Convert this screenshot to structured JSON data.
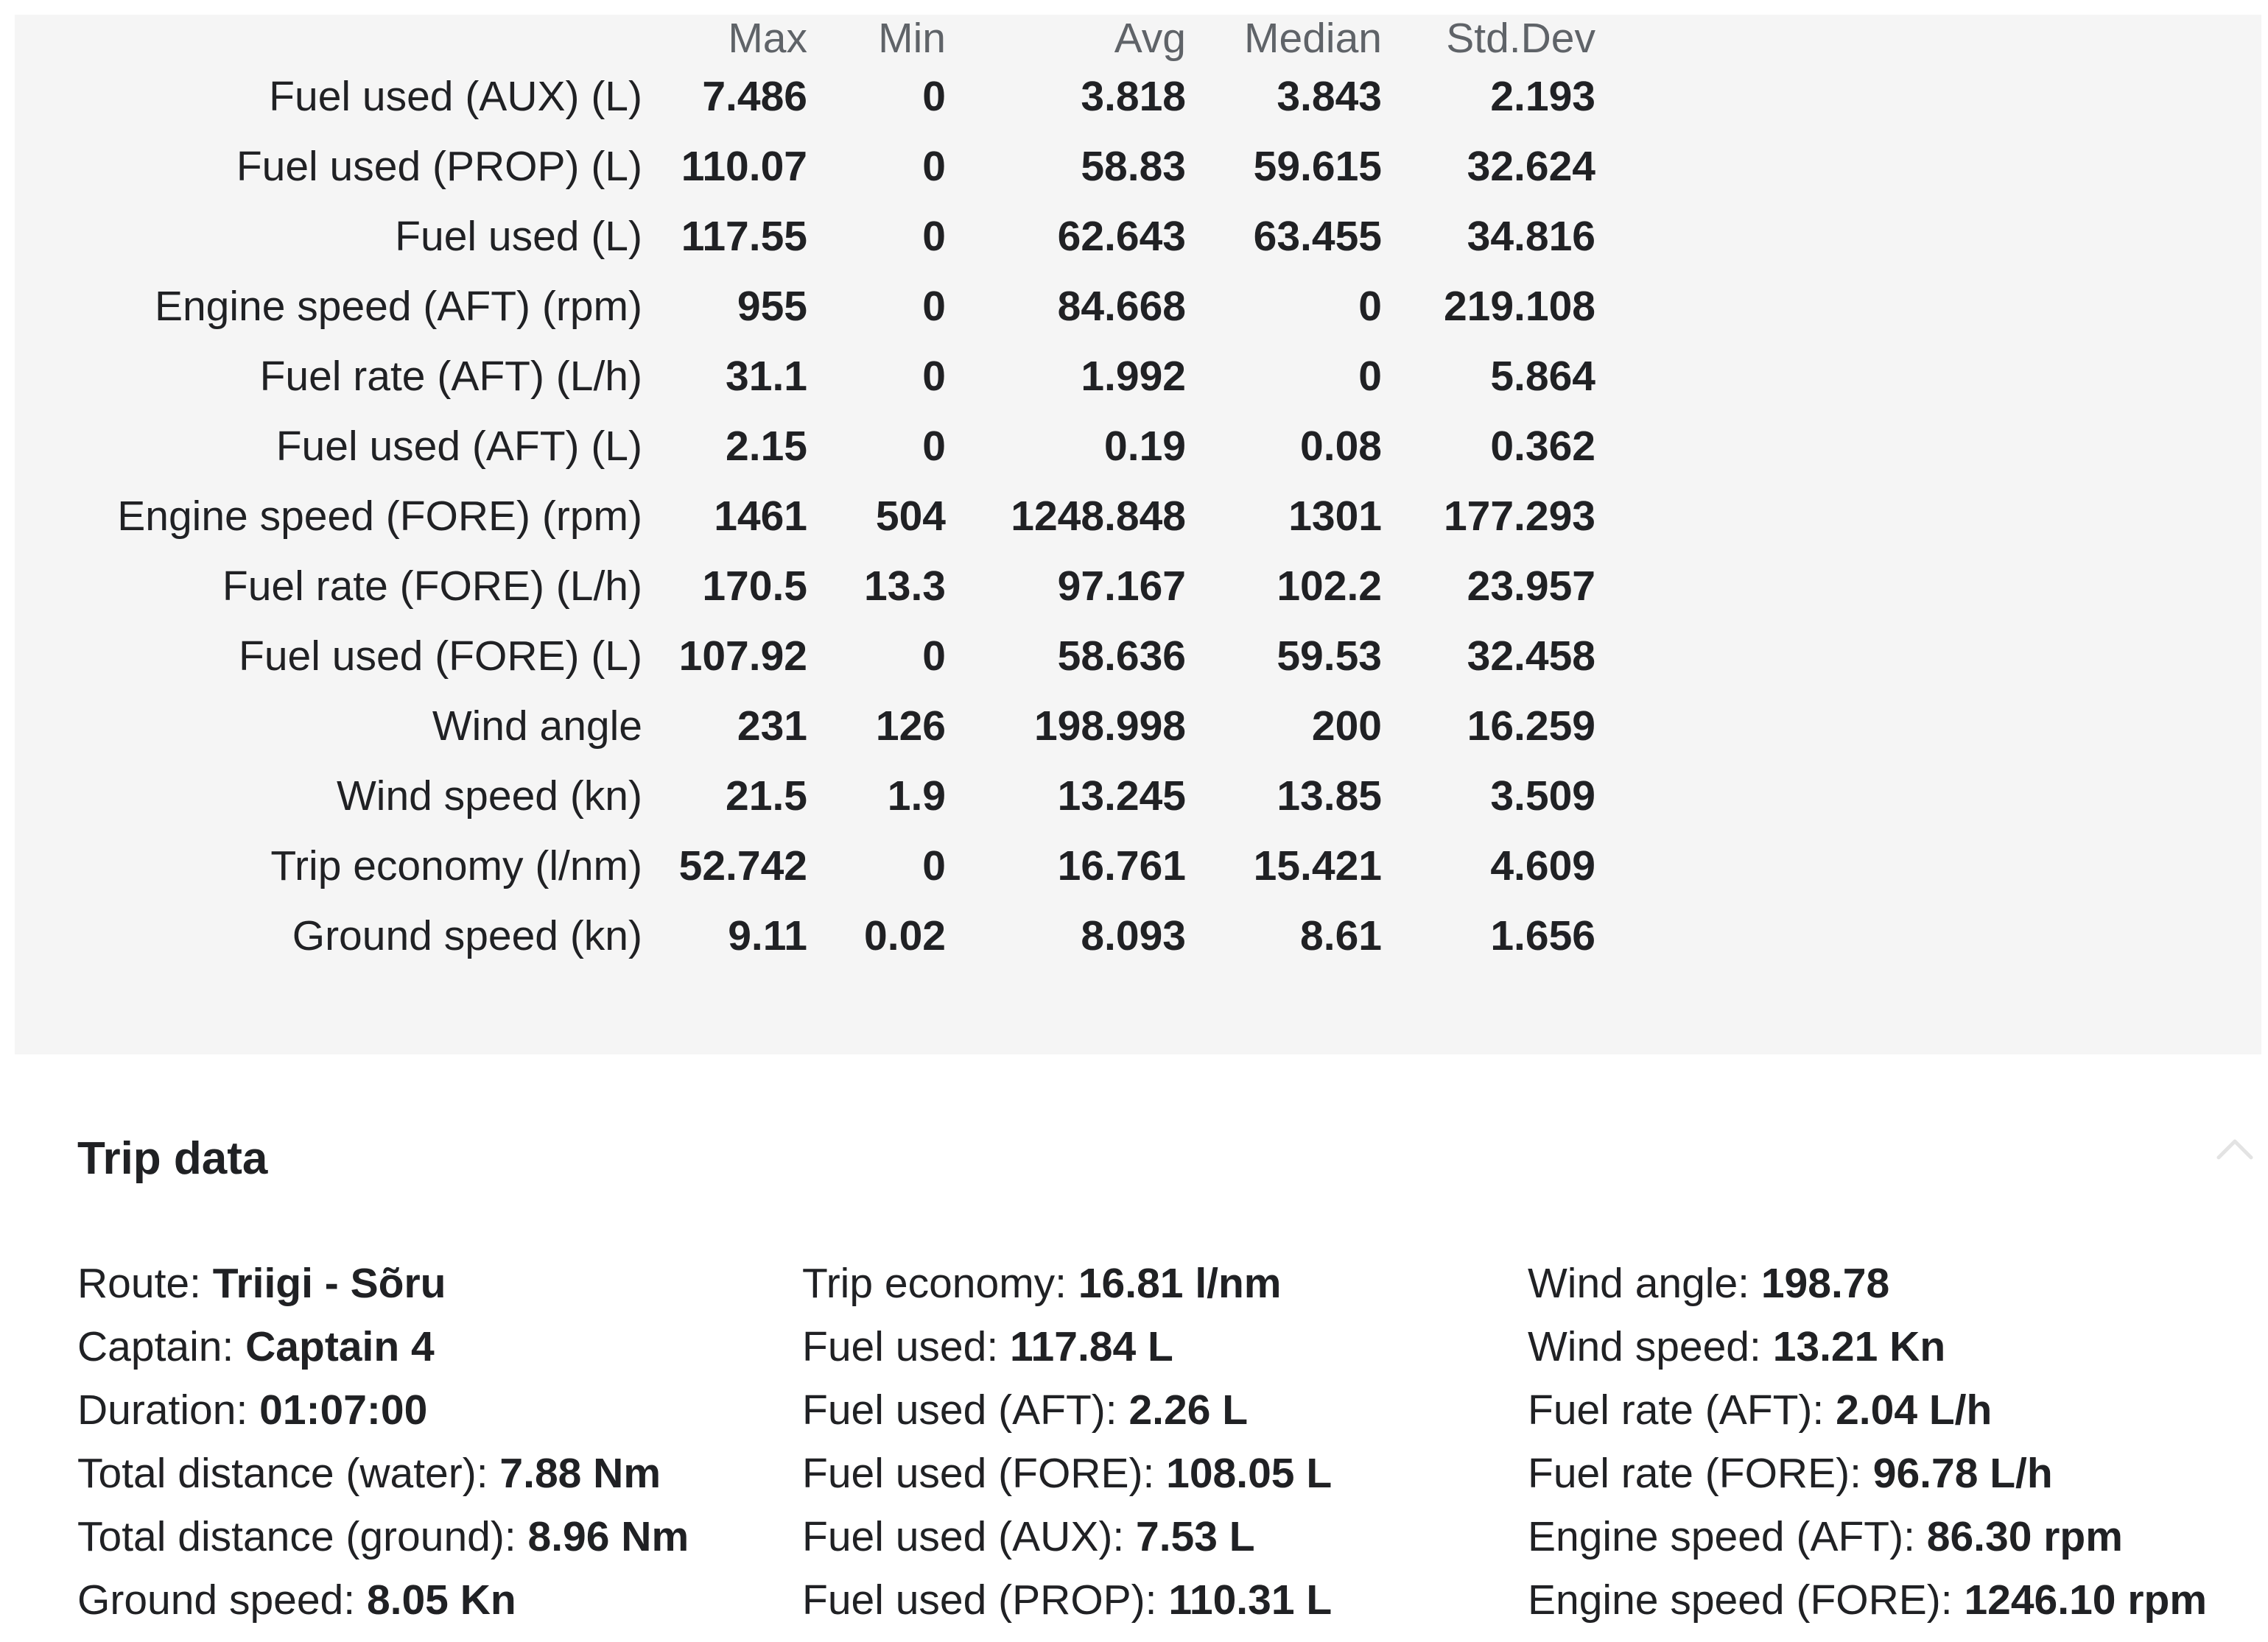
{
  "stats": {
    "headers": [
      "Max",
      "Min",
      "Avg",
      "Median",
      "Std.Dev"
    ],
    "rows": [
      {
        "label": "Fuel used (AUX) (L)",
        "max": "7.486",
        "min": "0",
        "avg": "3.818",
        "median": "3.843",
        "std": "2.193"
      },
      {
        "label": "Fuel used (PROP) (L)",
        "max": "110.07",
        "min": "0",
        "avg": "58.83",
        "median": "59.615",
        "std": "32.624"
      },
      {
        "label": "Fuel used (L)",
        "max": "117.55",
        "min": "0",
        "avg": "62.643",
        "median": "63.455",
        "std": "34.816"
      },
      {
        "label": "Engine speed (AFT) (rpm)",
        "max": "955",
        "min": "0",
        "avg": "84.668",
        "median": "0",
        "std": "219.108"
      },
      {
        "label": "Fuel rate (AFT) (L/h)",
        "max": "31.1",
        "min": "0",
        "avg": "1.992",
        "median": "0",
        "std": "5.864"
      },
      {
        "label": "Fuel used (AFT) (L)",
        "max": "2.15",
        "min": "0",
        "avg": "0.19",
        "median": "0.08",
        "std": "0.362"
      },
      {
        "label": "Engine speed (FORE) (rpm)",
        "max": "1461",
        "min": "504",
        "avg": "1248.848",
        "median": "1301",
        "std": "177.293"
      },
      {
        "label": "Fuel rate (FORE) (L/h)",
        "max": "170.5",
        "min": "13.3",
        "avg": "97.167",
        "median": "102.2",
        "std": "23.957"
      },
      {
        "label": "Fuel used (FORE) (L)",
        "max": "107.92",
        "min": "0",
        "avg": "58.636",
        "median": "59.53",
        "std": "32.458"
      },
      {
        "label": "Wind angle",
        "max": "231",
        "min": "126",
        "avg": "198.998",
        "median": "200",
        "std": "16.259"
      },
      {
        "label": "Wind speed (kn)",
        "max": "21.5",
        "min": "1.9",
        "avg": "13.245",
        "median": "13.85",
        "std": "3.509"
      },
      {
        "label": "Trip economy (l/nm)",
        "max": "52.742",
        "min": "0",
        "avg": "16.761",
        "median": "15.421",
        "std": "4.609"
      },
      {
        "label": "Ground speed (kn)",
        "max": "9.11",
        "min": "0.02",
        "avg": "8.093",
        "median": "8.61",
        "std": "1.656"
      }
    ]
  },
  "trip": {
    "title": "Trip data",
    "collapse_icon": "chevron-up-icon",
    "columns": [
      [
        {
          "label": "Route: ",
          "value": "Triigi - Sõru"
        },
        {
          "label": "Captain: ",
          "value": "Captain 4"
        },
        {
          "label": "Duration: ",
          "value": "01:07:00"
        },
        {
          "label": "Total distance (water): ",
          "value": "7.88 Nm"
        },
        {
          "label": "Total distance (ground): ",
          "value": "8.96 Nm"
        },
        {
          "label": "Ground speed: ",
          "value": "8.05 Kn"
        }
      ],
      [
        {
          "label": "Trip economy: ",
          "value": "16.81 l/nm"
        },
        {
          "label": "Fuel used: ",
          "value": "117.84 L"
        },
        {
          "label": "Fuel used (AFT): ",
          "value": "2.26 L"
        },
        {
          "label": "Fuel used (FORE): ",
          "value": "108.05 L"
        },
        {
          "label": "Fuel used (AUX): ",
          "value": "7.53 L"
        },
        {
          "label": "Fuel used (PROP): ",
          "value": "110.31 L"
        }
      ],
      [
        {
          "label": "Wind angle: ",
          "value": "198.78"
        },
        {
          "label": "Wind speed: ",
          "value": "13.21 Kn"
        },
        {
          "label": "Fuel rate (AFT): ",
          "value": "2.04 L/h"
        },
        {
          "label": "Fuel rate (FORE): ",
          "value": "96.78 L/h"
        },
        {
          "label": "Engine speed (AFT): ",
          "value": "86.30 rpm"
        },
        {
          "label": "Engine speed (FORE): ",
          "value": "1246.10 rpm"
        }
      ]
    ]
  }
}
